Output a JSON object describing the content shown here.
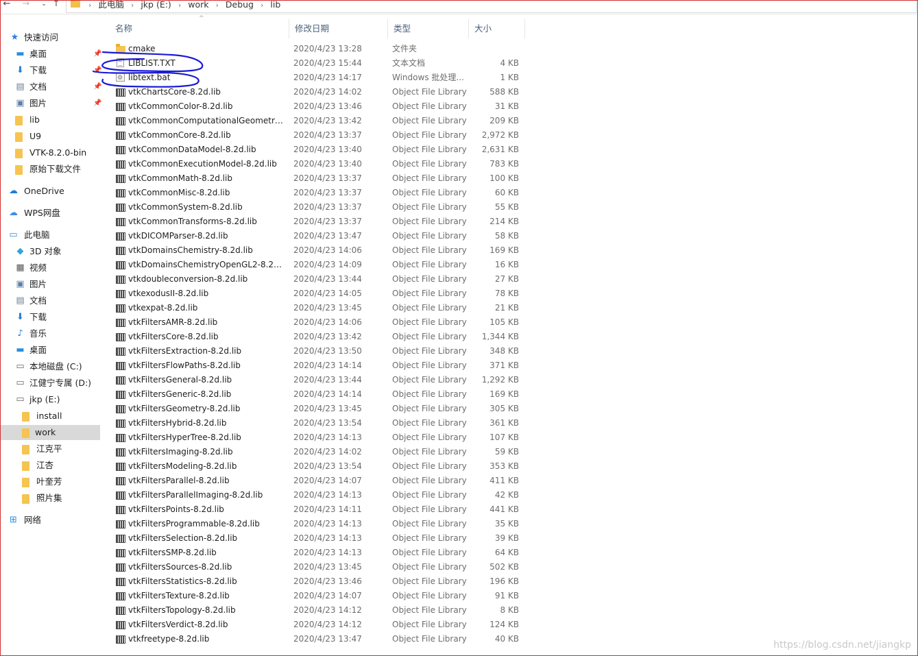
{
  "address": {
    "crumbs": [
      "此电脑",
      "jkp (E:)",
      "work",
      "Debug",
      "lib"
    ]
  },
  "nav": {
    "quick_access": "快速访问",
    "items": [
      {
        "label": "桌面",
        "icon": "desktop-icon",
        "pinned": true
      },
      {
        "label": "下载",
        "icon": "download-icon",
        "pinned": true
      },
      {
        "label": "文档",
        "icon": "document-icon",
        "pinned": true
      },
      {
        "label": "图片",
        "icon": "picture-icon",
        "pinned": true
      },
      {
        "label": "lib",
        "icon": "folder-icon"
      },
      {
        "label": "U9",
        "icon": "folder-icon"
      },
      {
        "label": "VTK-8.2.0-bin",
        "icon": "folder-icon"
      },
      {
        "label": "原始下载文件",
        "icon": "folder-icon"
      }
    ],
    "onedrive": "OneDrive",
    "wps": "WPS网盘",
    "this_pc": "此电脑",
    "pc_items": [
      {
        "label": "3D 对象",
        "icon": "cube-icon"
      },
      {
        "label": "视频",
        "icon": "video-icon"
      },
      {
        "label": "图片",
        "icon": "picture-icon"
      },
      {
        "label": "文档",
        "icon": "document-icon"
      },
      {
        "label": "下载",
        "icon": "download-icon"
      },
      {
        "label": "音乐",
        "icon": "music-icon"
      },
      {
        "label": "桌面",
        "icon": "desktop-icon"
      },
      {
        "label": "本地磁盘 (C:)",
        "icon": "drive-icon"
      },
      {
        "label": "江健宁专属 (D:)",
        "icon": "drive-icon"
      },
      {
        "label": "jkp (E:)",
        "icon": "drive-icon"
      }
    ],
    "e_items": [
      {
        "label": "install"
      },
      {
        "label": "work",
        "selected": true
      },
      {
        "label": "江克平"
      },
      {
        "label": "江杏"
      },
      {
        "label": "叶奎芳"
      },
      {
        "label": "照片集"
      }
    ],
    "network": "网络"
  },
  "columns": {
    "name": "名称",
    "date": "修改日期",
    "type": "类型",
    "size": "大小"
  },
  "files": [
    {
      "name": "cmake",
      "date": "2020/4/23 13:28",
      "type": "文件夹",
      "size": "",
      "icon": "folder"
    },
    {
      "name": "LIBLIST.TXT",
      "date": "2020/4/23 15:44",
      "type": "文本文档",
      "size": "4 KB",
      "icon": "txt"
    },
    {
      "name": "libtext.bat",
      "date": "2020/4/23 14:17",
      "type": "Windows 批处理...",
      "size": "1 KB",
      "icon": "bat"
    },
    {
      "name": "vtkChartsCore-8.2d.lib",
      "date": "2020/4/23 14:02",
      "type": "Object File Library",
      "size": "588 KB",
      "icon": "lib"
    },
    {
      "name": "vtkCommonColor-8.2d.lib",
      "date": "2020/4/23 13:46",
      "type": "Object File Library",
      "size": "31 KB",
      "icon": "lib"
    },
    {
      "name": "vtkCommonComputationalGeometry-...",
      "date": "2020/4/23 13:42",
      "type": "Object File Library",
      "size": "209 KB",
      "icon": "lib"
    },
    {
      "name": "vtkCommonCore-8.2d.lib",
      "date": "2020/4/23 13:37",
      "type": "Object File Library",
      "size": "2,972 KB",
      "icon": "lib"
    },
    {
      "name": "vtkCommonDataModel-8.2d.lib",
      "date": "2020/4/23 13:40",
      "type": "Object File Library",
      "size": "2,631 KB",
      "icon": "lib"
    },
    {
      "name": "vtkCommonExecutionModel-8.2d.lib",
      "date": "2020/4/23 13:40",
      "type": "Object File Library",
      "size": "783 KB",
      "icon": "lib"
    },
    {
      "name": "vtkCommonMath-8.2d.lib",
      "date": "2020/4/23 13:37",
      "type": "Object File Library",
      "size": "100 KB",
      "icon": "lib"
    },
    {
      "name": "vtkCommonMisc-8.2d.lib",
      "date": "2020/4/23 13:37",
      "type": "Object File Library",
      "size": "60 KB",
      "icon": "lib"
    },
    {
      "name": "vtkCommonSystem-8.2d.lib",
      "date": "2020/4/23 13:37",
      "type": "Object File Library",
      "size": "55 KB",
      "icon": "lib"
    },
    {
      "name": "vtkCommonTransforms-8.2d.lib",
      "date": "2020/4/23 13:37",
      "type": "Object File Library",
      "size": "214 KB",
      "icon": "lib"
    },
    {
      "name": "vtkDICOMParser-8.2d.lib",
      "date": "2020/4/23 13:47",
      "type": "Object File Library",
      "size": "58 KB",
      "icon": "lib"
    },
    {
      "name": "vtkDomainsChemistry-8.2d.lib",
      "date": "2020/4/23 14:06",
      "type": "Object File Library",
      "size": "169 KB",
      "icon": "lib"
    },
    {
      "name": "vtkDomainsChemistryOpenGL2-8.2d.lib",
      "date": "2020/4/23 14:09",
      "type": "Object File Library",
      "size": "16 KB",
      "icon": "lib"
    },
    {
      "name": "vtkdoubleconversion-8.2d.lib",
      "date": "2020/4/23 13:44",
      "type": "Object File Library",
      "size": "27 KB",
      "icon": "lib"
    },
    {
      "name": "vtkexodusII-8.2d.lib",
      "date": "2020/4/23 14:05",
      "type": "Object File Library",
      "size": "78 KB",
      "icon": "lib"
    },
    {
      "name": "vtkexpat-8.2d.lib",
      "date": "2020/4/23 13:45",
      "type": "Object File Library",
      "size": "21 KB",
      "icon": "lib"
    },
    {
      "name": "vtkFiltersAMR-8.2d.lib",
      "date": "2020/4/23 14:06",
      "type": "Object File Library",
      "size": "105 KB",
      "icon": "lib"
    },
    {
      "name": "vtkFiltersCore-8.2d.lib",
      "date": "2020/4/23 13:42",
      "type": "Object File Library",
      "size": "1,344 KB",
      "icon": "lib"
    },
    {
      "name": "vtkFiltersExtraction-8.2d.lib",
      "date": "2020/4/23 13:50",
      "type": "Object File Library",
      "size": "348 KB",
      "icon": "lib"
    },
    {
      "name": "vtkFiltersFlowPaths-8.2d.lib",
      "date": "2020/4/23 14:14",
      "type": "Object File Library",
      "size": "371 KB",
      "icon": "lib"
    },
    {
      "name": "vtkFiltersGeneral-8.2d.lib",
      "date": "2020/4/23 13:44",
      "type": "Object File Library",
      "size": "1,292 KB",
      "icon": "lib"
    },
    {
      "name": "vtkFiltersGeneric-8.2d.lib",
      "date": "2020/4/23 14:14",
      "type": "Object File Library",
      "size": "169 KB",
      "icon": "lib"
    },
    {
      "name": "vtkFiltersGeometry-8.2d.lib",
      "date": "2020/4/23 13:45",
      "type": "Object File Library",
      "size": "305 KB",
      "icon": "lib"
    },
    {
      "name": "vtkFiltersHybrid-8.2d.lib",
      "date": "2020/4/23 13:54",
      "type": "Object File Library",
      "size": "361 KB",
      "icon": "lib"
    },
    {
      "name": "vtkFiltersHyperTree-8.2d.lib",
      "date": "2020/4/23 14:13",
      "type": "Object File Library",
      "size": "107 KB",
      "icon": "lib"
    },
    {
      "name": "vtkFiltersImaging-8.2d.lib",
      "date": "2020/4/23 14:02",
      "type": "Object File Library",
      "size": "59 KB",
      "icon": "lib"
    },
    {
      "name": "vtkFiltersModeling-8.2d.lib",
      "date": "2020/4/23 13:54",
      "type": "Object File Library",
      "size": "353 KB",
      "icon": "lib"
    },
    {
      "name": "vtkFiltersParallel-8.2d.lib",
      "date": "2020/4/23 14:07",
      "type": "Object File Library",
      "size": "411 KB",
      "icon": "lib"
    },
    {
      "name": "vtkFiltersParallelImaging-8.2d.lib",
      "date": "2020/4/23 14:13",
      "type": "Object File Library",
      "size": "42 KB",
      "icon": "lib"
    },
    {
      "name": "vtkFiltersPoints-8.2d.lib",
      "date": "2020/4/23 14:11",
      "type": "Object File Library",
      "size": "441 KB",
      "icon": "lib"
    },
    {
      "name": "vtkFiltersProgrammable-8.2d.lib",
      "date": "2020/4/23 14:13",
      "type": "Object File Library",
      "size": "35 KB",
      "icon": "lib"
    },
    {
      "name": "vtkFiltersSelection-8.2d.lib",
      "date": "2020/4/23 14:13",
      "type": "Object File Library",
      "size": "39 KB",
      "icon": "lib"
    },
    {
      "name": "vtkFiltersSMP-8.2d.lib",
      "date": "2020/4/23 14:13",
      "type": "Object File Library",
      "size": "64 KB",
      "icon": "lib"
    },
    {
      "name": "vtkFiltersSources-8.2d.lib",
      "date": "2020/4/23 13:45",
      "type": "Object File Library",
      "size": "502 KB",
      "icon": "lib"
    },
    {
      "name": "vtkFiltersStatistics-8.2d.lib",
      "date": "2020/4/23 13:46",
      "type": "Object File Library",
      "size": "196 KB",
      "icon": "lib"
    },
    {
      "name": "vtkFiltersTexture-8.2d.lib",
      "date": "2020/4/23 14:07",
      "type": "Object File Library",
      "size": "91 KB",
      "icon": "lib"
    },
    {
      "name": "vtkFiltersTopology-8.2d.lib",
      "date": "2020/4/23 14:12",
      "type": "Object File Library",
      "size": "8 KB",
      "icon": "lib"
    },
    {
      "name": "vtkFiltersVerdict-8.2d.lib",
      "date": "2020/4/23 14:12",
      "type": "Object File Library",
      "size": "124 KB",
      "icon": "lib"
    },
    {
      "name": "vtkfreetype-8.2d.lib",
      "date": "2020/4/23 13:47",
      "type": "Object File Library",
      "size": "40 KB",
      "icon": "lib"
    }
  ],
  "watermark": "https://blog.csdn.net/jiangkp",
  "colors": {
    "annotation": "#1a1ad6",
    "frame": "#d32f2f",
    "selected_bg": "#d9d9d9"
  }
}
